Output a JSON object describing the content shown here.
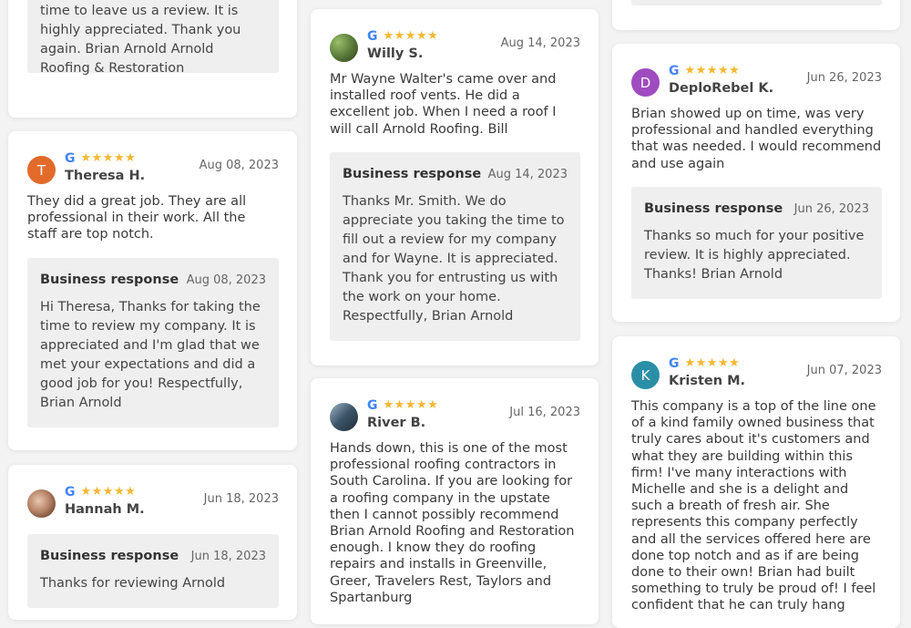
{
  "source_letter": "G",
  "stars": "★★★★★",
  "response_title": "Business response",
  "reviews": {
    "top_left_tail": {
      "response_text": "time to leave us a review. It is highly appreciated. Thank you again. Brian Arnold Arnold Roofing & Restoration"
    },
    "theresa": {
      "initial": "T",
      "avatar_color": "#e26b2a",
      "name": "Theresa H.",
      "date": "Aug 08, 2023",
      "text": "They did a great job. They are all professional in their work. All the staff are top notch.",
      "response_date": "Aug 08, 2023",
      "response_text": "Hi Theresa, Thanks for taking the time to review my company. It is appreciated and I'm glad that we met your expectations and did a good job for you! Respectfully, Brian Arnold"
    },
    "hannah": {
      "name": "Hannah M.",
      "date": "Jun 18, 2023",
      "response_date": "Jun 18, 2023",
      "response_text": "Thanks for reviewing Arnold"
    },
    "willy": {
      "name": "Willy S.",
      "date": "Aug 14, 2023",
      "text": "Mr Wayne Walter's came over and installed roof vents. He did a excellent job. When I need a roof I will call Arnold Roofing. Bill",
      "response_date": "Aug 14, 2023",
      "response_text": "Thanks Mr. Smith. We do appreciate you taking the time to fill out a review for my company and for Wayne. It is appreciated. Thank you for entrusting us with the work on your home. Respectfully, Brian Arnold"
    },
    "river": {
      "name": "River B.",
      "date": "Jul 16, 2023",
      "text": "Hands down, this is one of the most professional roofing contractors in South Carolina. If you are looking for a roofing company in the upstate then I cannot possibly recommend Brian Arnold Roofing and Restoration enough. I know they do roofing repairs and installs in Greenville, Greer, Travelers Rest, Taylors and Spartanburg"
    },
    "deplo": {
      "initial": "D",
      "avatar_color": "#a04bc0",
      "name": "DeploRebel K.",
      "date": "Jun 26, 2023",
      "text": "Brian showed up on time, was very professional and handled everything that was needed. I would recommend and use again",
      "response_date": "Jun 26, 2023",
      "response_text": "Thanks so much for your positive review. It is highly appreciated. Thanks! Brian Arnold"
    },
    "kristen": {
      "initial": "K",
      "avatar_color": "#2a8fa6",
      "name": "Kristen M.",
      "date": "Jun 07, 2023",
      "text": "This company is a top of the line one of a kind family owned business that truly cares about it's customers and what they are building within this firm! I've many interactions with Michelle and she is a delight and such a breath of fresh air. She represents this company perfectly and all the services offered here are done top notch and as if are being done to their own! Brian had built something to truly be proud of! I feel confident that he can truly hang"
    }
  }
}
